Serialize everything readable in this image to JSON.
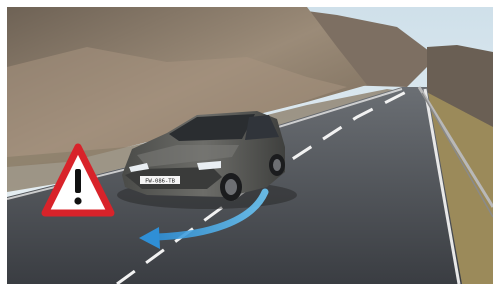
{
  "scene": {
    "description_type": "illustration",
    "license_plate": "FW-086-TB",
    "colors": {
      "sky": "#d9e7ef",
      "rock": "#8a7a6a",
      "road": "#4b4f55",
      "car_body": "#5a5b58",
      "arrow": "#3aa8e8",
      "warning_red": "#d8232a",
      "warning_fill": "#ffffff"
    },
    "icons": {
      "warning": "warning-triangle-icon",
      "direction": "curved-arrow-icon"
    }
  }
}
